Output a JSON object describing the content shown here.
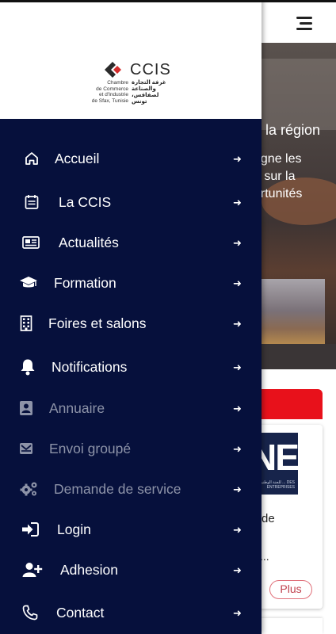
{
  "header": {
    "close_glyph": "×",
    "menu_icon": "hamburger-icon"
  },
  "brand": {
    "name": "CCIS",
    "french_lines": [
      "Chambre",
      "de Commerce",
      "et d'Industrie",
      "de Sfax, Tunisie"
    ],
    "arabic_lines": [
      "غرفة التجارة",
      "والصناعة",
      "لصفاقس، تونس"
    ]
  },
  "menu": {
    "items": [
      {
        "label": "Accueil",
        "icon": "home-icon",
        "enabled": true
      },
      {
        "label": "La CCIS",
        "icon": "calendar-icon",
        "enabled": true
      },
      {
        "label": "Actualités",
        "icon": "newspaper-icon",
        "enabled": true
      },
      {
        "label": "Formation",
        "icon": "graduation-cap-icon",
        "enabled": true
      },
      {
        "label": "Foires et salons",
        "icon": "building-icon",
        "enabled": true
      },
      {
        "label": "Notifications",
        "icon": "bell-icon",
        "enabled": true
      },
      {
        "label": "Annuaire",
        "icon": "address-book-icon",
        "enabled": false
      },
      {
        "label": "Envoi groupé",
        "icon": "envelope-icon",
        "enabled": false
      },
      {
        "label": "Demande de service",
        "icon": "gears-icon",
        "enabled": false
      },
      {
        "label": "Login",
        "icon": "sign-in-icon",
        "enabled": true
      },
      {
        "label": "Adhesion",
        "icon": "user-plus-icon",
        "enabled": true
      },
      {
        "label": "Contact",
        "icon": "phone-icon",
        "enabled": true
      }
    ],
    "arrow_glyph": "➜"
  },
  "background": {
    "hero": {
      "title_fragment": "e la région",
      "line1": "agne les",
      "line2": "e sur la",
      "line3": "ortunités"
    },
    "card": {
      "logo_text": "NE",
      "logo_subtext": "للجنة الوطنية ... DES ENTREPRISES",
      "text": "de",
      "dots": "...",
      "plus_label": "Plus"
    }
  },
  "colors": {
    "drawer_bg": "#06103c",
    "accent_red": "#e8111b",
    "dim_text": "#8d93a8"
  }
}
